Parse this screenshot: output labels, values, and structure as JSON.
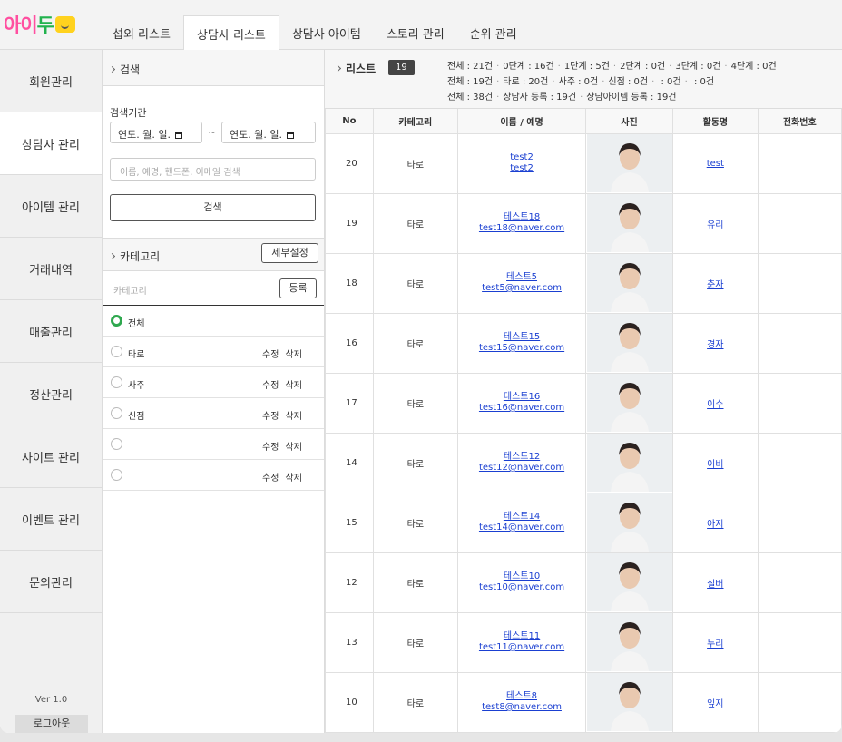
{
  "logo": {
    "text_pink": "아이",
    "text_green": "두"
  },
  "tabs": [
    {
      "label": "섭외 리스트"
    },
    {
      "label": "상담사 리스트"
    },
    {
      "label": "상담사 아이템"
    },
    {
      "label": "스토리 관리"
    },
    {
      "label": "순위 관리"
    }
  ],
  "sidebar": {
    "items": [
      {
        "label": "회원관리"
      },
      {
        "label": "상담사 관리"
      },
      {
        "label": "아이템 관리"
      },
      {
        "label": "거래내역"
      },
      {
        "label": "매출관리"
      },
      {
        "label": "정산관리"
      },
      {
        "label": "사이트 관리"
      },
      {
        "label": "이벤트 관리"
      },
      {
        "label": "문의관리"
      }
    ],
    "version": "Ver 1.0",
    "logout": "로그아웃"
  },
  "search": {
    "header": "검색",
    "period_label": "검색기간",
    "date_from": "연도. 월. 일.",
    "date_to": "연도. 월. 일.",
    "tilde": "~",
    "placeholder": "이름, 예명, 핸드폰, 이메일 검색",
    "button": "검색"
  },
  "category": {
    "header": "카테고리",
    "detail_button": "세부설정",
    "input_placeholder": "카테고리",
    "register_button": "등록",
    "edit": "수정",
    "delete": "삭제",
    "items": [
      {
        "name": "전체",
        "selected": true,
        "actions": false
      },
      {
        "name": "타로",
        "selected": false,
        "actions": true
      },
      {
        "name": "사주",
        "selected": false,
        "actions": true
      },
      {
        "name": "신점",
        "selected": false,
        "actions": true
      },
      {
        "name": "",
        "selected": false,
        "actions": true
      },
      {
        "name": "",
        "selected": false,
        "actions": true
      }
    ]
  },
  "list": {
    "title": "리스트",
    "count": "19",
    "stats_line1": [
      "전체 : 21건",
      "0단계 : 16건",
      "1단계 : 5건",
      "2단계 : 0건",
      "3단계 : 0건",
      "4단계 : 0건"
    ],
    "stats_line2": [
      "전체 : 19건",
      "타로 : 20건",
      "사주 : 0건",
      "신점 : 0건",
      " : 0건",
      " : 0건"
    ],
    "stats_line3": [
      "전체 : 38건",
      "상담사 등록 : 19건",
      "상담아이템 등록 : 19건"
    ],
    "columns": [
      "No",
      "카테고리",
      "이름 / 예명",
      "사진",
      "활동명",
      "전화번호"
    ],
    "rows": [
      {
        "no": "20",
        "category": "타로",
        "name": "test2",
        "sub": "test2",
        "activity": "test"
      },
      {
        "no": "19",
        "category": "타로",
        "name": "테스트18",
        "sub": "test18@naver.com",
        "activity": "유리"
      },
      {
        "no": "18",
        "category": "타로",
        "name": "테스트5",
        "sub": "test5@naver.com",
        "activity": "춘자"
      },
      {
        "no": "16",
        "category": "타로",
        "name": "테스트15",
        "sub": "test15@naver.com",
        "activity": "경자"
      },
      {
        "no": "17",
        "category": "타로",
        "name": "테스트16",
        "sub": "test16@naver.com",
        "activity": "이수"
      },
      {
        "no": "14",
        "category": "타로",
        "name": "테스트12",
        "sub": "test12@naver.com",
        "activity": "이비"
      },
      {
        "no": "15",
        "category": "타로",
        "name": "테스트14",
        "sub": "test14@naver.com",
        "activity": "아지"
      },
      {
        "no": "12",
        "category": "타로",
        "name": "테스트10",
        "sub": "test10@naver.com",
        "activity": "실버"
      },
      {
        "no": "13",
        "category": "타로",
        "name": "테스트11",
        "sub": "test11@naver.com",
        "activity": "누리"
      },
      {
        "no": "10",
        "category": "타로",
        "name": "테스트8",
        "sub": "test8@naver.com",
        "activity": "잎지"
      }
    ]
  },
  "colors": {
    "logo_pink": "#ff4fa0",
    "logo_green": "#21b24d",
    "link": "#1a3fd1",
    "radio_on": "#2fa84f"
  }
}
